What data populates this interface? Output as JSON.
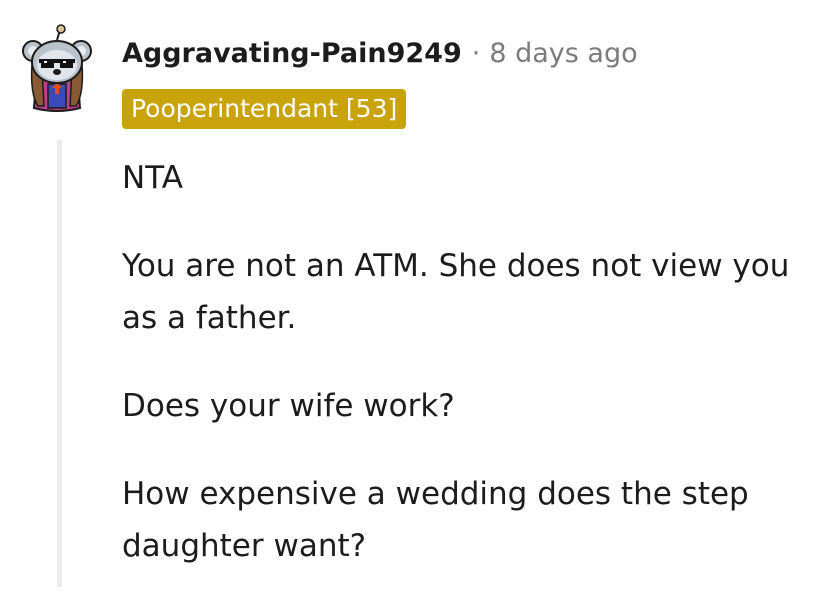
{
  "comment": {
    "author": "Aggravating-Pain9249",
    "separator": "·",
    "timestamp": "8 days ago",
    "flair": "Pooperintendant [53]",
    "paragraphs": [
      "NTA",
      "You are not an ATM. She does not view you as a father.",
      "Does your wife work?",
      "How expensive a wedding does the step daughter want?"
    ]
  },
  "colors": {
    "flair_background": "#c8a40a",
    "meta_text": "#7c7c7c",
    "body_text": "#1c1c1c",
    "thread_line": "#eaedef"
  },
  "icons": {
    "avatar": "snoo-avatar-with-pixel-sunglasses"
  }
}
